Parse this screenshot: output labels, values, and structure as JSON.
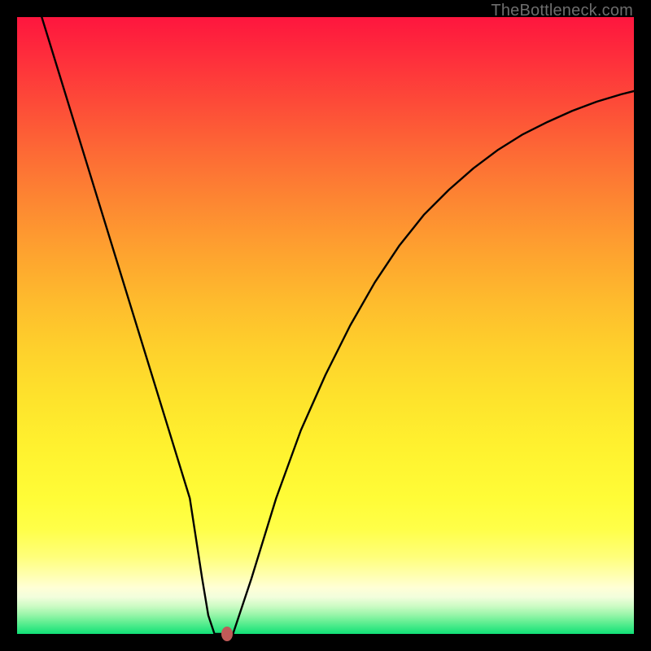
{
  "watermark": "TheBottleneck.com",
  "chart_data": {
    "type": "line",
    "title": "",
    "xlabel": "",
    "ylabel": "",
    "xlim": [
      0,
      100
    ],
    "ylim": [
      0,
      100
    ],
    "grid": false,
    "series": [
      {
        "name": "bottleneck-curve",
        "x": [
          4,
          8,
          12,
          16,
          20,
          24,
          28,
          30,
          31,
          32,
          33,
          34,
          35,
          36,
          38,
          42,
          46,
          50,
          54,
          58,
          62,
          66,
          70,
          74,
          78,
          82,
          86,
          90,
          94,
          98,
          100
        ],
        "values": [
          100,
          87,
          74,
          61,
          48,
          35,
          22,
          9,
          3,
          0,
          0,
          0,
          0,
          3,
          9,
          22,
          33,
          42,
          50,
          57,
          63,
          68,
          72,
          75.5,
          78.5,
          81,
          83,
          84.8,
          86.3,
          87.5,
          88
        ]
      }
    ],
    "marker": {
      "x": 34.0,
      "y": 0.0,
      "color": "#bf5a58"
    },
    "gradient_stops": [
      {
        "offset": 0.0,
        "color": "#fe163e"
      },
      {
        "offset": 0.06,
        "color": "#fe2c3c"
      },
      {
        "offset": 0.14,
        "color": "#fd4b38"
      },
      {
        "offset": 0.22,
        "color": "#fd6a35"
      },
      {
        "offset": 0.3,
        "color": "#fd8732"
      },
      {
        "offset": 0.38,
        "color": "#fea22f"
      },
      {
        "offset": 0.46,
        "color": "#febb2d"
      },
      {
        "offset": 0.54,
        "color": "#fed12c"
      },
      {
        "offset": 0.62,
        "color": "#fee32c"
      },
      {
        "offset": 0.7,
        "color": "#fff22f"
      },
      {
        "offset": 0.78,
        "color": "#fffc37"
      },
      {
        "offset": 0.83,
        "color": "#ffff48"
      },
      {
        "offset": 0.875,
        "color": "#ffff7a"
      },
      {
        "offset": 0.905,
        "color": "#ffffb0"
      },
      {
        "offset": 0.925,
        "color": "#ffffd6"
      },
      {
        "offset": 0.94,
        "color": "#f2fedc"
      },
      {
        "offset": 0.955,
        "color": "#ccfbc4"
      },
      {
        "offset": 0.968,
        "color": "#9cf6ab"
      },
      {
        "offset": 0.98,
        "color": "#67ef94"
      },
      {
        "offset": 0.992,
        "color": "#33e782"
      },
      {
        "offset": 1.0,
        "color": "#10e177"
      }
    ]
  }
}
